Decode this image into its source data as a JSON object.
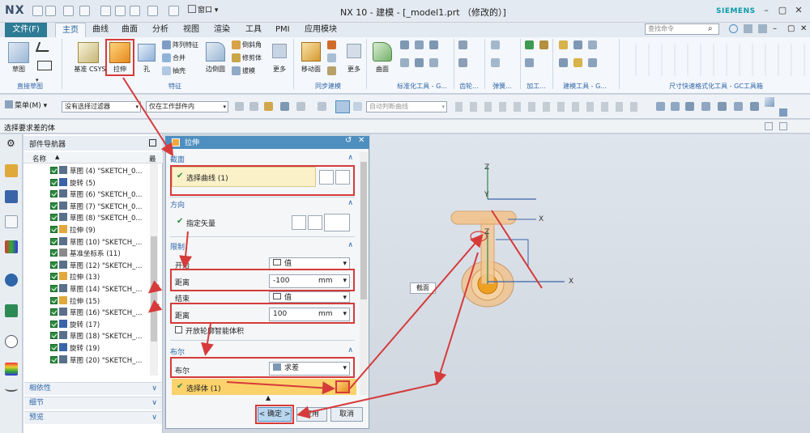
{
  "app": {
    "logo": "NX",
    "title": "NX 10 - 建模 - [_model1.prt （修改的）]",
    "brand": "SIEMENS",
    "window_menu": "窗口",
    "accent": "#2e7b94"
  },
  "ribbon_tabs": [
    "文件(F)",
    "主页",
    "曲线",
    "曲面",
    "分析",
    "视图",
    "渲染",
    "工具",
    "PMI",
    "应用模块"
  ],
  "search_placeholder": "查找命令",
  "ribbon": {
    "sketch": "草图",
    "datum_csys": "基准 CSYS",
    "extrude": "拉伸",
    "hole": "孔",
    "pattern": "阵列特征",
    "unite": "合并",
    "shell": "抽壳",
    "edge_blend": "边倒圆",
    "chamfer": "倒斜角",
    "trim_body": "修剪体",
    "draft": "拔模",
    "more1": "更多",
    "move_face": "移动面",
    "more2": "更多",
    "surface": "曲面",
    "more3": "更多",
    "groups": {
      "direct_sketch": "直接草图",
      "feature": "特征",
      "sync": "同步建模",
      "std": "标准化工具 - G...",
      "gear": "齿轮...",
      "spring": "弹簧...",
      "machining": "加工...",
      "build": "建模工具 - G...",
      "dim": "尺寸快速格式化工具 - GC工具箱"
    }
  },
  "toolbar": {
    "menu": "菜单(M)",
    "filter": "没有选择过滤器",
    "scope": "仅在工作部件内",
    "snap": "自动判断曲线"
  },
  "status": "选择要求差的体",
  "navigator": {
    "title": "部件导航器",
    "col_name": "名称",
    "col_latest": "最",
    "items": [
      {
        "label": "草图 (4) \"SKETCH_0...",
        "icon": "sketch-icon"
      },
      {
        "label": "旋转 (5)",
        "icon": "revolve-icon"
      },
      {
        "label": "草图 (6) \"SKETCH_0...",
        "icon": "sketch-icon"
      },
      {
        "label": "草图 (7) \"SKETCH_0...",
        "icon": "sketch-icon"
      },
      {
        "label": "草图 (8) \"SKETCH_0...",
        "icon": "sketch-icon"
      },
      {
        "label": "拉伸 (9)",
        "icon": "extrude-icon"
      },
      {
        "label": "草图 (10) \"SKETCH_...",
        "icon": "sketch-icon"
      },
      {
        "label": "基准坐标系 (11)",
        "icon": "csys-icon"
      },
      {
        "label": "草图 (12) \"SKETCH_...",
        "icon": "sketch-icon"
      },
      {
        "label": "拉伸 (13)",
        "icon": "extrude-icon"
      },
      {
        "label": "草图 (14) \"SKETCH_...",
        "icon": "sketch-icon"
      },
      {
        "label": "拉伸 (15)",
        "icon": "extrude-icon"
      },
      {
        "label": "草图 (16) \"SKETCH_...",
        "icon": "sketch-icon"
      },
      {
        "label": "旋转 (17)",
        "icon": "revolve-icon"
      },
      {
        "label": "草图 (18) \"SKETCH_...",
        "icon": "sketch-icon"
      },
      {
        "label": "旋转 (19)",
        "icon": "revolve-icon"
      },
      {
        "label": "草图 (20) \"SKETCH_...",
        "icon": "sketch-icon"
      }
    ],
    "panels": [
      "相依性",
      "细节",
      "预览"
    ]
  },
  "dialog": {
    "title": "拉伸",
    "section": "截面",
    "select_curve": "选择曲线 (1)",
    "direction": "方向",
    "vector": "指定矢量",
    "limits": "限制",
    "start": "开始",
    "start_type": "值",
    "distance1_label": "距离",
    "distance1": "-100",
    "unit1": "mm",
    "end": "结束",
    "end_type": "值",
    "distance2_label": "距离",
    "distance2": "100",
    "unit2": "mm",
    "open_profile": "开放轮廓智能体积",
    "boolean": "布尔",
    "boolean_label": "布尔",
    "boolean_value": "求差",
    "select_body": "选择体 (1)",
    "ok": "< 确定 >",
    "apply": "应用",
    "cancel": "取消"
  },
  "viewport": {
    "axis_x": "X",
    "axis_y": "Y",
    "axis_z": "Z",
    "tag": "截面"
  }
}
